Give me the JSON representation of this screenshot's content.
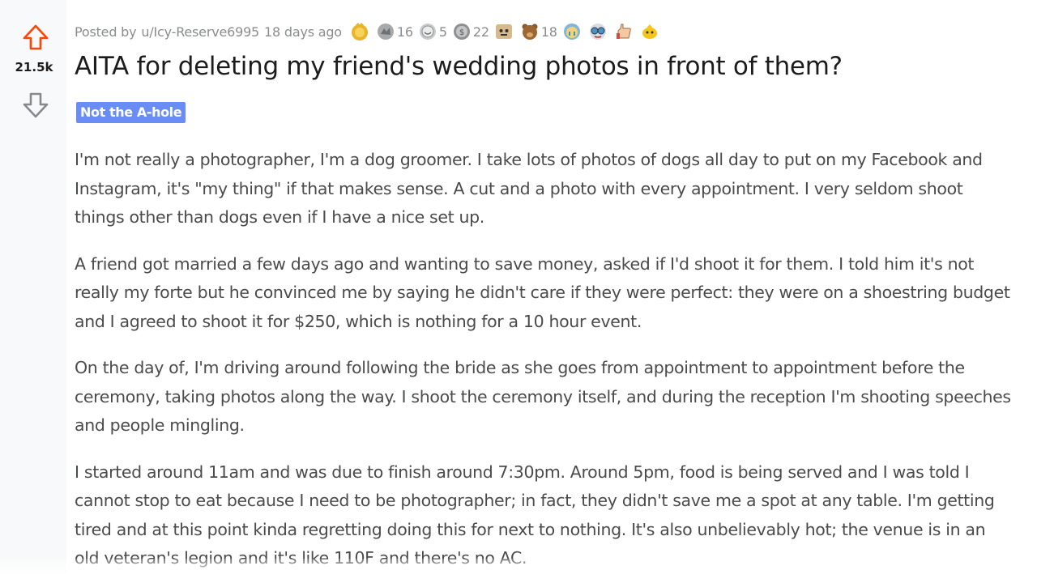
{
  "vote": {
    "score": "21.5k",
    "upvote_icon": "upvote-arrow-icon",
    "downvote_icon": "downvote-arrow-icon",
    "upvote_color": "#ff4500"
  },
  "post": {
    "posted_by_label": "Posted by",
    "author": "u/Icy-Reserve6995",
    "age": "18 days ago",
    "awards": [
      {
        "icon": "gold-award-icon",
        "count": ""
      },
      {
        "icon": "helpful-award-icon",
        "count": "16"
      },
      {
        "icon": "wholesome-award-icon",
        "count": "5"
      },
      {
        "icon": "silver-award-icon",
        "count": "22"
      },
      {
        "icon": "face-award-icon",
        "count": ""
      },
      {
        "icon": "bear-award-icon",
        "count": "18"
      },
      {
        "icon": "tears-award-icon",
        "count": ""
      },
      {
        "icon": "goggles-award-icon",
        "count": ""
      },
      {
        "icon": "hand-award-icon",
        "count": ""
      },
      {
        "icon": "bee-award-icon",
        "count": ""
      }
    ],
    "title": "AITA for deleting my friend's wedding photos in front of them?",
    "flair": "Not the A-hole",
    "flair_color": "#6a8cf5",
    "paragraphs": [
      "I'm not really a photographer, I'm a dog groomer. I take lots of photos of dogs all day to put on my Facebook and Instagram, it's \"my thing\" if that makes sense. A cut and a photo with every appointment. I very seldom shoot things other than dogs even if I have a nice set up.",
      "A friend got married a few days ago and wanting to save money, asked if I'd shoot it for them. I told him it's not really my forte but he convinced me by saying he didn't care if they were perfect: they were on a shoestring budget and I agreed to shoot it for $250, which is nothing for a 10 hour event.",
      "On the day of, I'm driving around following the bride as she goes from appointment to appointment before the ceremony, taking photos along the way. I shoot the ceremony itself, and during the reception I'm shooting speeches and people mingling.",
      "I started around 11am and was due to finish around 7:30pm. Around 5pm, food is being served and I was told I cannot stop to eat because I need to be photographer; in fact, they didn't save me a spot at any table. I'm getting tired and at this point kinda regretting doing this for next to nothing. It's also unbelievably hot; the venue is in an old veteran's legion and it's like 110F and there's no AC."
    ]
  }
}
